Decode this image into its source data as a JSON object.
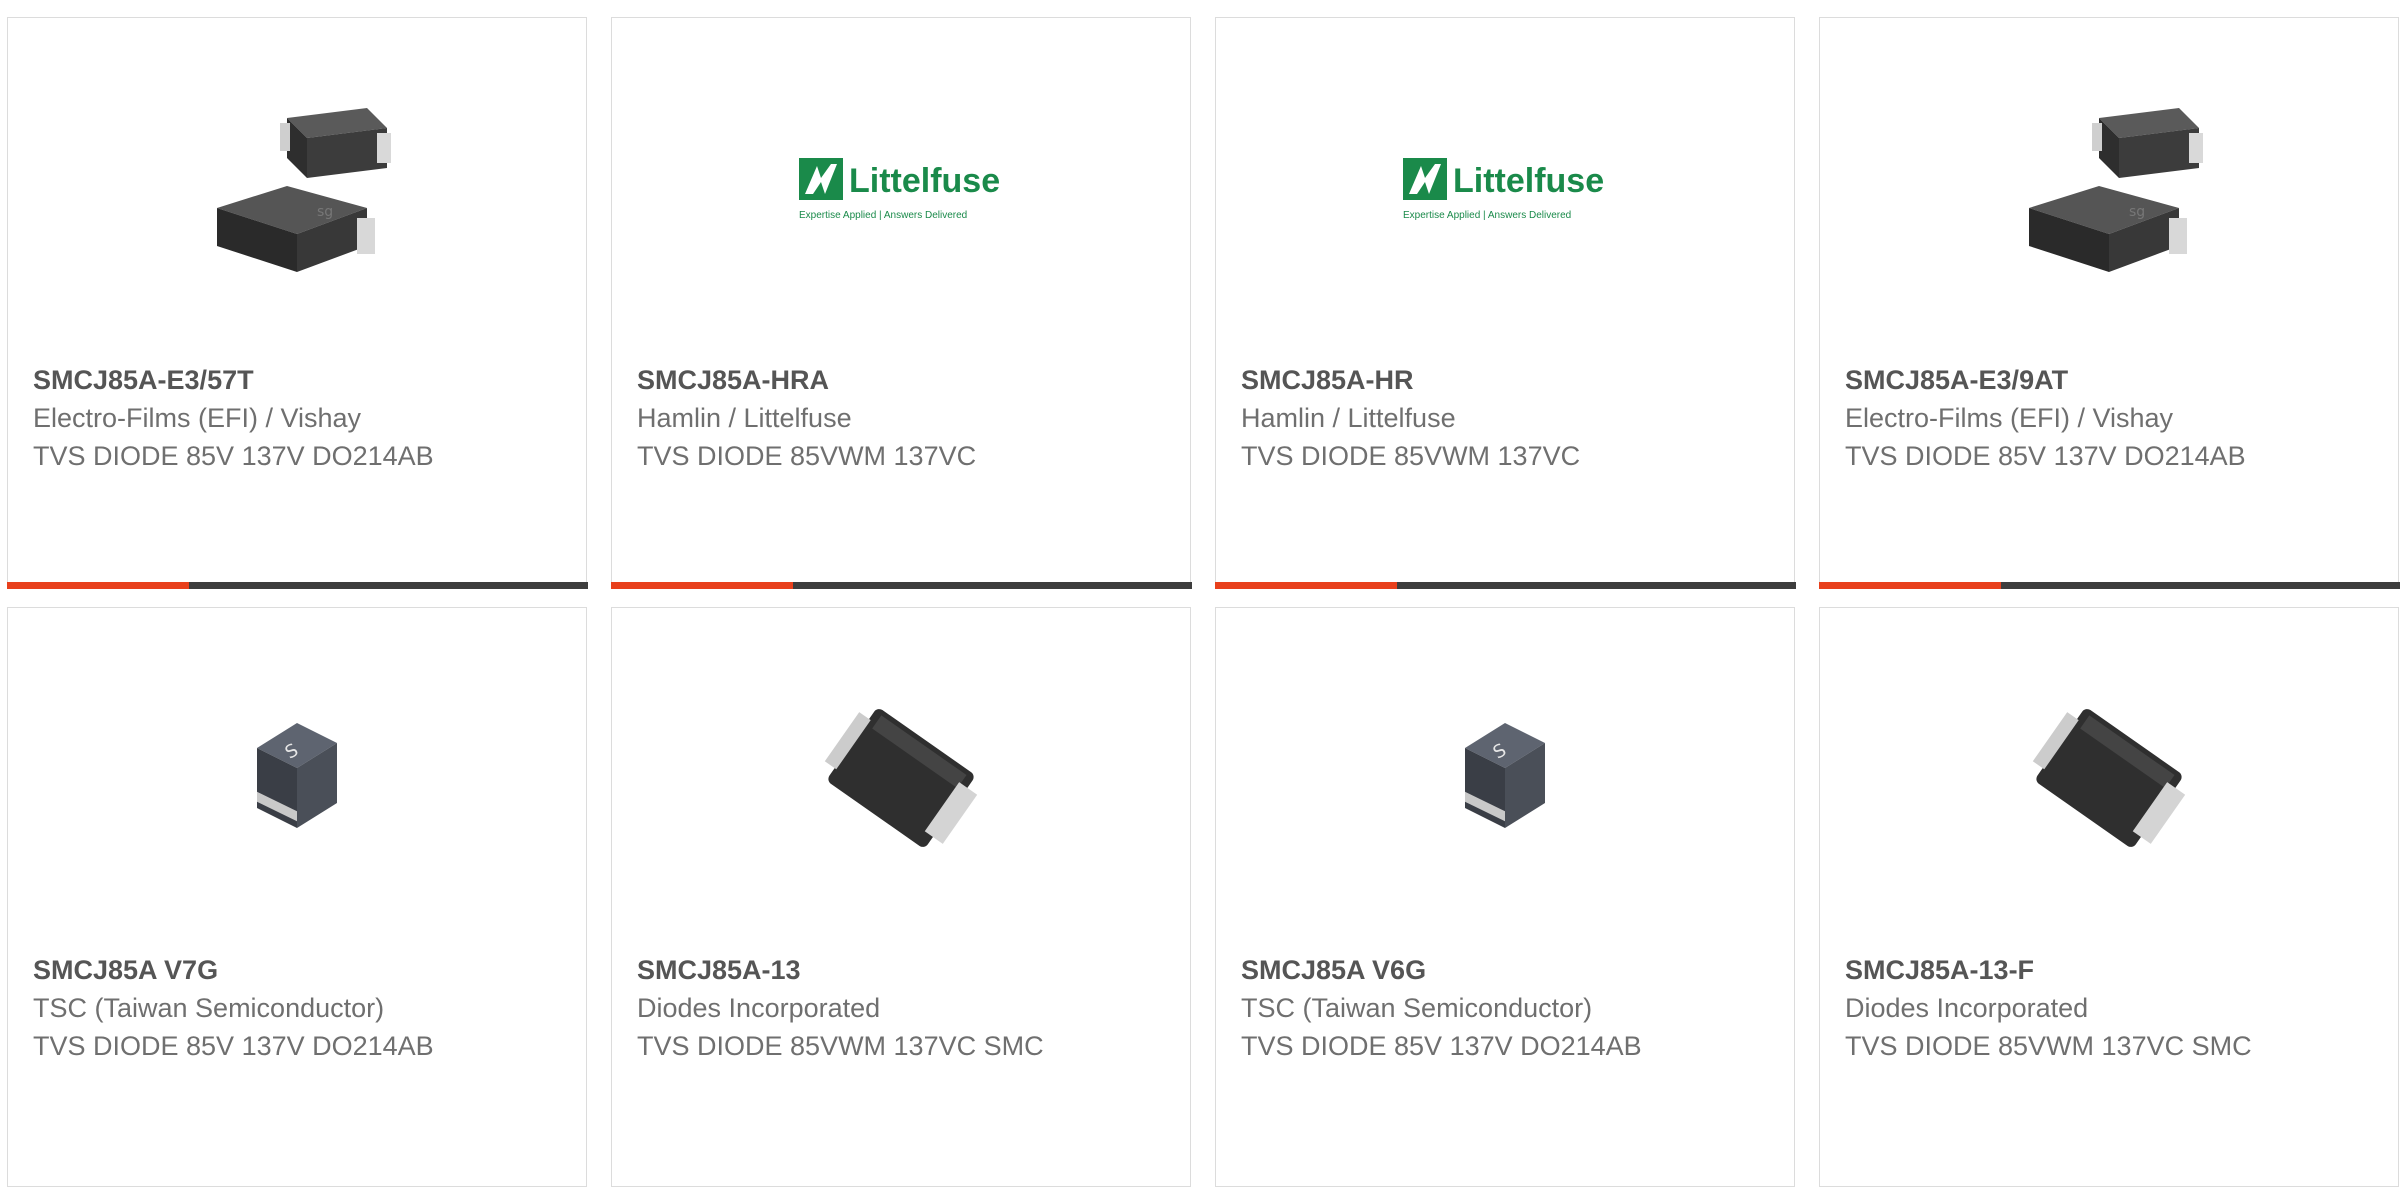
{
  "colors": {
    "accent": "#e8401c",
    "bar": "#3d3d3d",
    "border": "#dcdcdc",
    "logo_green": "#1a8a4a"
  },
  "products": [
    {
      "part": "SMCJ85A-E3/57T",
      "manufacturer": "Electro-Films (EFI) / Vishay",
      "description": "TVS DIODE 85V 137V DO214AB",
      "image": "smc-diode-pair-icon"
    },
    {
      "part": "SMCJ85A-HRA",
      "manufacturer": "Hamlin / Littelfuse",
      "description": "TVS DIODE 85VWM 137VC",
      "image": "littelfuse-logo",
      "logo_text": "Littelfuse",
      "logo_tagline": "Expertise Applied | Answers Delivered"
    },
    {
      "part": "SMCJ85A-HR",
      "manufacturer": "Hamlin / Littelfuse",
      "description": "TVS DIODE 85VWM 137VC",
      "image": "littelfuse-logo",
      "logo_text": "Littelfuse",
      "logo_tagline": "Expertise Applied | Answers Delivered"
    },
    {
      "part": "SMCJ85A-E3/9AT",
      "manufacturer": "Electro-Films (EFI) / Vishay",
      "description": "TVS DIODE 85V 137V DO214AB",
      "image": "smc-diode-pair-icon"
    },
    {
      "part": "SMCJ85A V7G",
      "manufacturer": "TSC (Taiwan Semiconductor)",
      "description": "TVS DIODE 85V 137V DO214AB",
      "image": "tsc-diode-icon"
    },
    {
      "part": "SMCJ85A-13",
      "manufacturer": "Diodes Incorporated",
      "description": "TVS DIODE 85VWM 137VC SMC",
      "image": "smc-diode-icon"
    },
    {
      "part": "SMCJ85A V6G",
      "manufacturer": "TSC (Taiwan Semiconductor)",
      "description": "TVS DIODE 85V 137V DO214AB",
      "image": "tsc-diode-icon"
    },
    {
      "part": "SMCJ85A-13-F",
      "manufacturer": "Diodes Incorporated",
      "description": "TVS DIODE 85VWM 137VC SMC",
      "image": "smc-diode-icon"
    }
  ]
}
